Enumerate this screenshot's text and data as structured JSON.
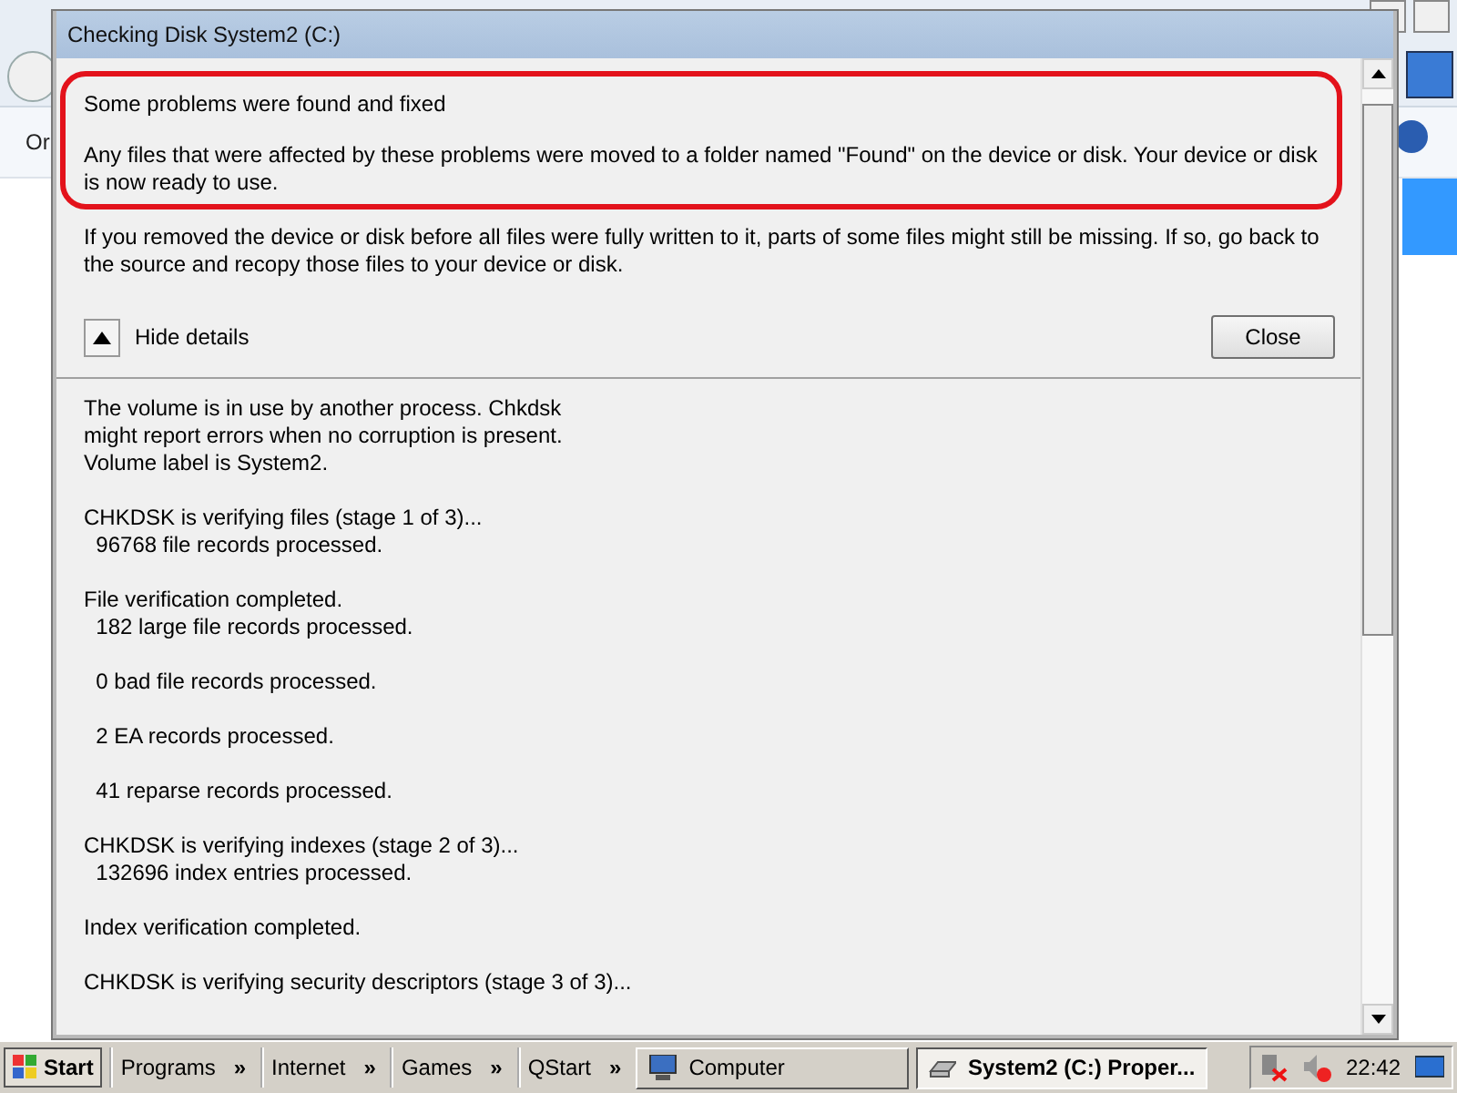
{
  "background_window": {
    "menu_text": "Or"
  },
  "dialog": {
    "title": "Checking Disk System2 (C:)",
    "result_heading": "Some problems were found and fixed",
    "result_text": "Any files that were affected by these problems were moved to a folder named \"Found\" on the device or disk. Your device or disk is now ready to use.",
    "note": "If you removed the device or disk before all files were fully written to it, parts of some files might still be missing. If so, go back to the source and recopy those files to your device or disk.",
    "details_toggle": {
      "label": "Hide details",
      "expanded": true
    },
    "close_button": "Close",
    "log": [
      [
        "The volume is in use by another process. Chkdsk",
        "might report errors when no corruption is present.",
        "Volume label is System2."
      ],
      [
        "CHKDSK is verifying files (stage 1 of 3)...",
        "  96768 file records processed."
      ],
      [
        "File verification completed.",
        "  182 large file records processed."
      ],
      [
        "  0 bad file records processed."
      ],
      [
        "  2 EA records processed."
      ],
      [
        "  41 reparse records processed."
      ],
      [
        "CHKDSK is verifying indexes (stage 2 of 3)...",
        "  132696 index entries processed."
      ],
      [
        "Index verification completed."
      ],
      [
        "CHKDSK is verifying security descriptors (stage 3 of 3)..."
      ]
    ]
  },
  "taskbar": {
    "start": "Start",
    "toolbars": [
      {
        "label": "Programs",
        "chevron": "»"
      },
      {
        "label": "Internet",
        "chevron": "»"
      },
      {
        "label": "Games",
        "chevron": "»"
      },
      {
        "label": "QStart",
        "chevron": "»"
      }
    ],
    "tasks": [
      {
        "label": "Computer",
        "selected": false
      },
      {
        "label": "System2 (C:) Proper...",
        "selected": true
      }
    ],
    "clock": "22:42"
  }
}
